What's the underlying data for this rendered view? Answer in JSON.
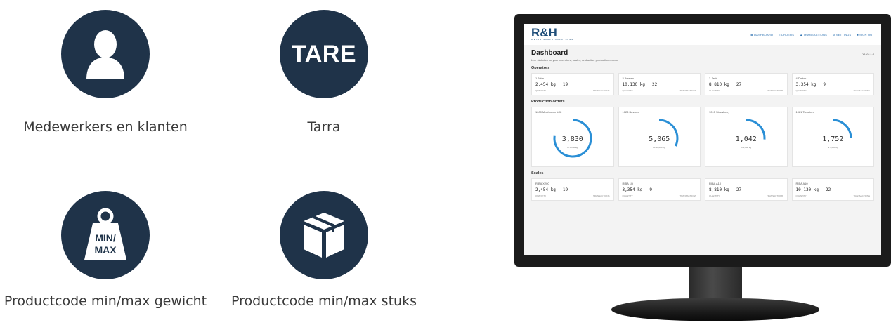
{
  "features": [
    {
      "caption": "Medewerkers en klanten",
      "icon": "user-icon"
    },
    {
      "caption": "Tarra",
      "icon_text": "TARE",
      "icon": "tare-icon"
    },
    {
      "caption": "Productcode min/max gewicht",
      "icon_text_1": "MIN/",
      "icon_text_2": "MAX",
      "icon": "weight-icon"
    },
    {
      "caption": "Productcode min/max stuks",
      "icon": "box-icon"
    }
  ],
  "colors": {
    "circle": "#1f3349",
    "accent": "#2a6fb0"
  },
  "dashboard": {
    "logo": "R&H",
    "logo_sub": "WEIGH SCALE SOLUTIONS",
    "nav": [
      {
        "icon": "dashboard-icon",
        "label": "Dashboard"
      },
      {
        "icon": "orders-icon",
        "label": "Orders"
      },
      {
        "icon": "transactions-icon",
        "label": "Transactions"
      },
      {
        "icon": "settings-icon",
        "label": "Settings"
      },
      {
        "icon": "user-icon",
        "label": "Sign out"
      }
    ],
    "title": "Dashboard",
    "version": "v1.22.1.4",
    "subtitle": "Live statistics for your operators, scales, and active production orders.",
    "operators_title": "Operators",
    "operators": [
      {
        "name": "1 John",
        "qty": "2,454 kg",
        "tx": "19"
      },
      {
        "name": "2 Warren",
        "qty": "10,130 kg",
        "tx": "22"
      },
      {
        "name": "3 Jack",
        "qty": "8,810 kg",
        "tx": "27"
      },
      {
        "name": "4 Dalton",
        "qty": "3,354 kg",
        "tx": "9"
      }
    ],
    "qty_label": "Quantity",
    "tx_label": "Transactions",
    "orders_title": "Production orders",
    "orders": [
      {
        "name": "1000 Mushroom #C2",
        "value": "3,830",
        "of": "of 5,000 kg",
        "progress": 0.77
      },
      {
        "name": "1023 Bessen",
        "value": "5,065",
        "of": "of 16,000 kg",
        "progress": 0.32
      },
      {
        "name": "1015 Strawberry",
        "value": "1,042",
        "of": "of 4,000 kg",
        "progress": 0.26
      },
      {
        "name": "1021 Tomaten",
        "value": "1,752",
        "of": "of 7,000 kg",
        "progress": 0.25
      }
    ],
    "scales_title": "Scales",
    "scales": [
      {
        "name": "RIBA X200",
        "qty": "2,454 kg",
        "tx": "19"
      },
      {
        "name": "RIBA 10i",
        "qty": "3,354 kg",
        "tx": "9"
      },
      {
        "name": "RIBA A10",
        "qty": "8,810 kg",
        "tx": "27"
      },
      {
        "name": "RIBA A10",
        "qty": "10,130 kg",
        "tx": "22"
      }
    ]
  }
}
